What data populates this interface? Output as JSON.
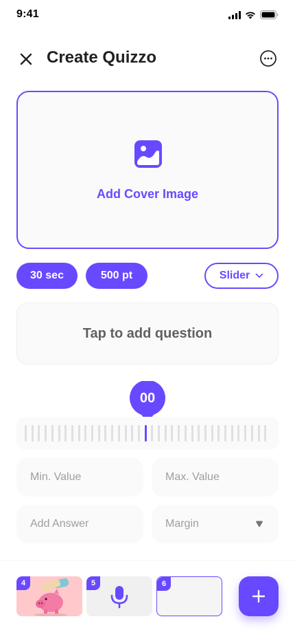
{
  "status_bar": {
    "time": "9:41"
  },
  "header": {
    "title": "Create Quizzo",
    "close_icon": "close-icon",
    "more_icon": "more-options-icon"
  },
  "cover": {
    "label": "Add Cover Image",
    "icon": "image-icon"
  },
  "options": {
    "time_limit": "30 sec",
    "points": "500 pt",
    "question_type": "Slider",
    "question_type_icon": "chevron-down-icon"
  },
  "question": {
    "placeholder": "Tap to add question"
  },
  "slider": {
    "value_label": "00"
  },
  "fields": {
    "min_placeholder": "Min. Value",
    "max_placeholder": "Max. Value",
    "answer_placeholder": "Add Answer",
    "margin_placeholder": "Margin"
  },
  "thumbnails": [
    {
      "number": "4",
      "content": "piggy-bank-image"
    },
    {
      "number": "5",
      "content": "microphone-icon"
    },
    {
      "number": "6",
      "content": "empty"
    }
  ],
  "add_button_icon": "plus-icon",
  "colors": {
    "accent": "#6949FF",
    "field_bg": "#FAFAFA",
    "placeholder": "#9E9E9E"
  }
}
